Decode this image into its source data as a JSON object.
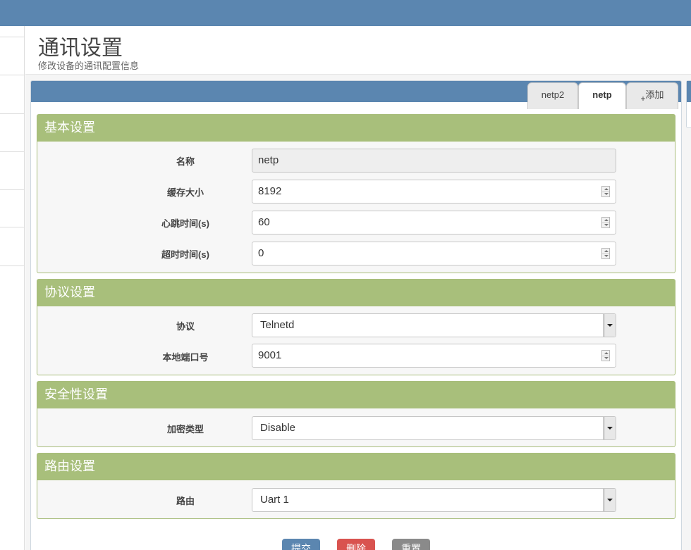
{
  "page": {
    "title": "通讯设置",
    "subtitle": "修改设备的通讯配置信息"
  },
  "tabs": [
    {
      "label": "netp2"
    },
    {
      "label": "netp"
    },
    {
      "plus": "+",
      "label": "添加"
    }
  ],
  "sections": {
    "basic": {
      "title": "基本设置",
      "name_label": "名称",
      "name_value": "netp",
      "cache_label": "缓存大小",
      "cache_value": "8192",
      "heartbeat_label": "心跳时间(s)",
      "heartbeat_value": "60",
      "timeout_label": "超时时间(s)",
      "timeout_value": "0"
    },
    "protocol": {
      "title": "协议设置",
      "protocol_label": "协议",
      "protocol_value": "Telnetd",
      "port_label": "本地端口号",
      "port_value": "9001"
    },
    "security": {
      "title": "安全性设置",
      "encrypt_label": "加密类型",
      "encrypt_value": "Disable"
    },
    "routing": {
      "title": "路由设置",
      "route_label": "路由",
      "route_value": "Uart 1"
    }
  },
  "buttons": {
    "submit": "提交",
    "delete": "删除",
    "reset": "重置"
  },
  "colors": {
    "header_blue": "#5b86b0",
    "section_green": "#a8bf7b",
    "submit_blue": "#5b86b0",
    "delete_red": "#d9534f",
    "reset_gray": "#8a8a8a"
  }
}
